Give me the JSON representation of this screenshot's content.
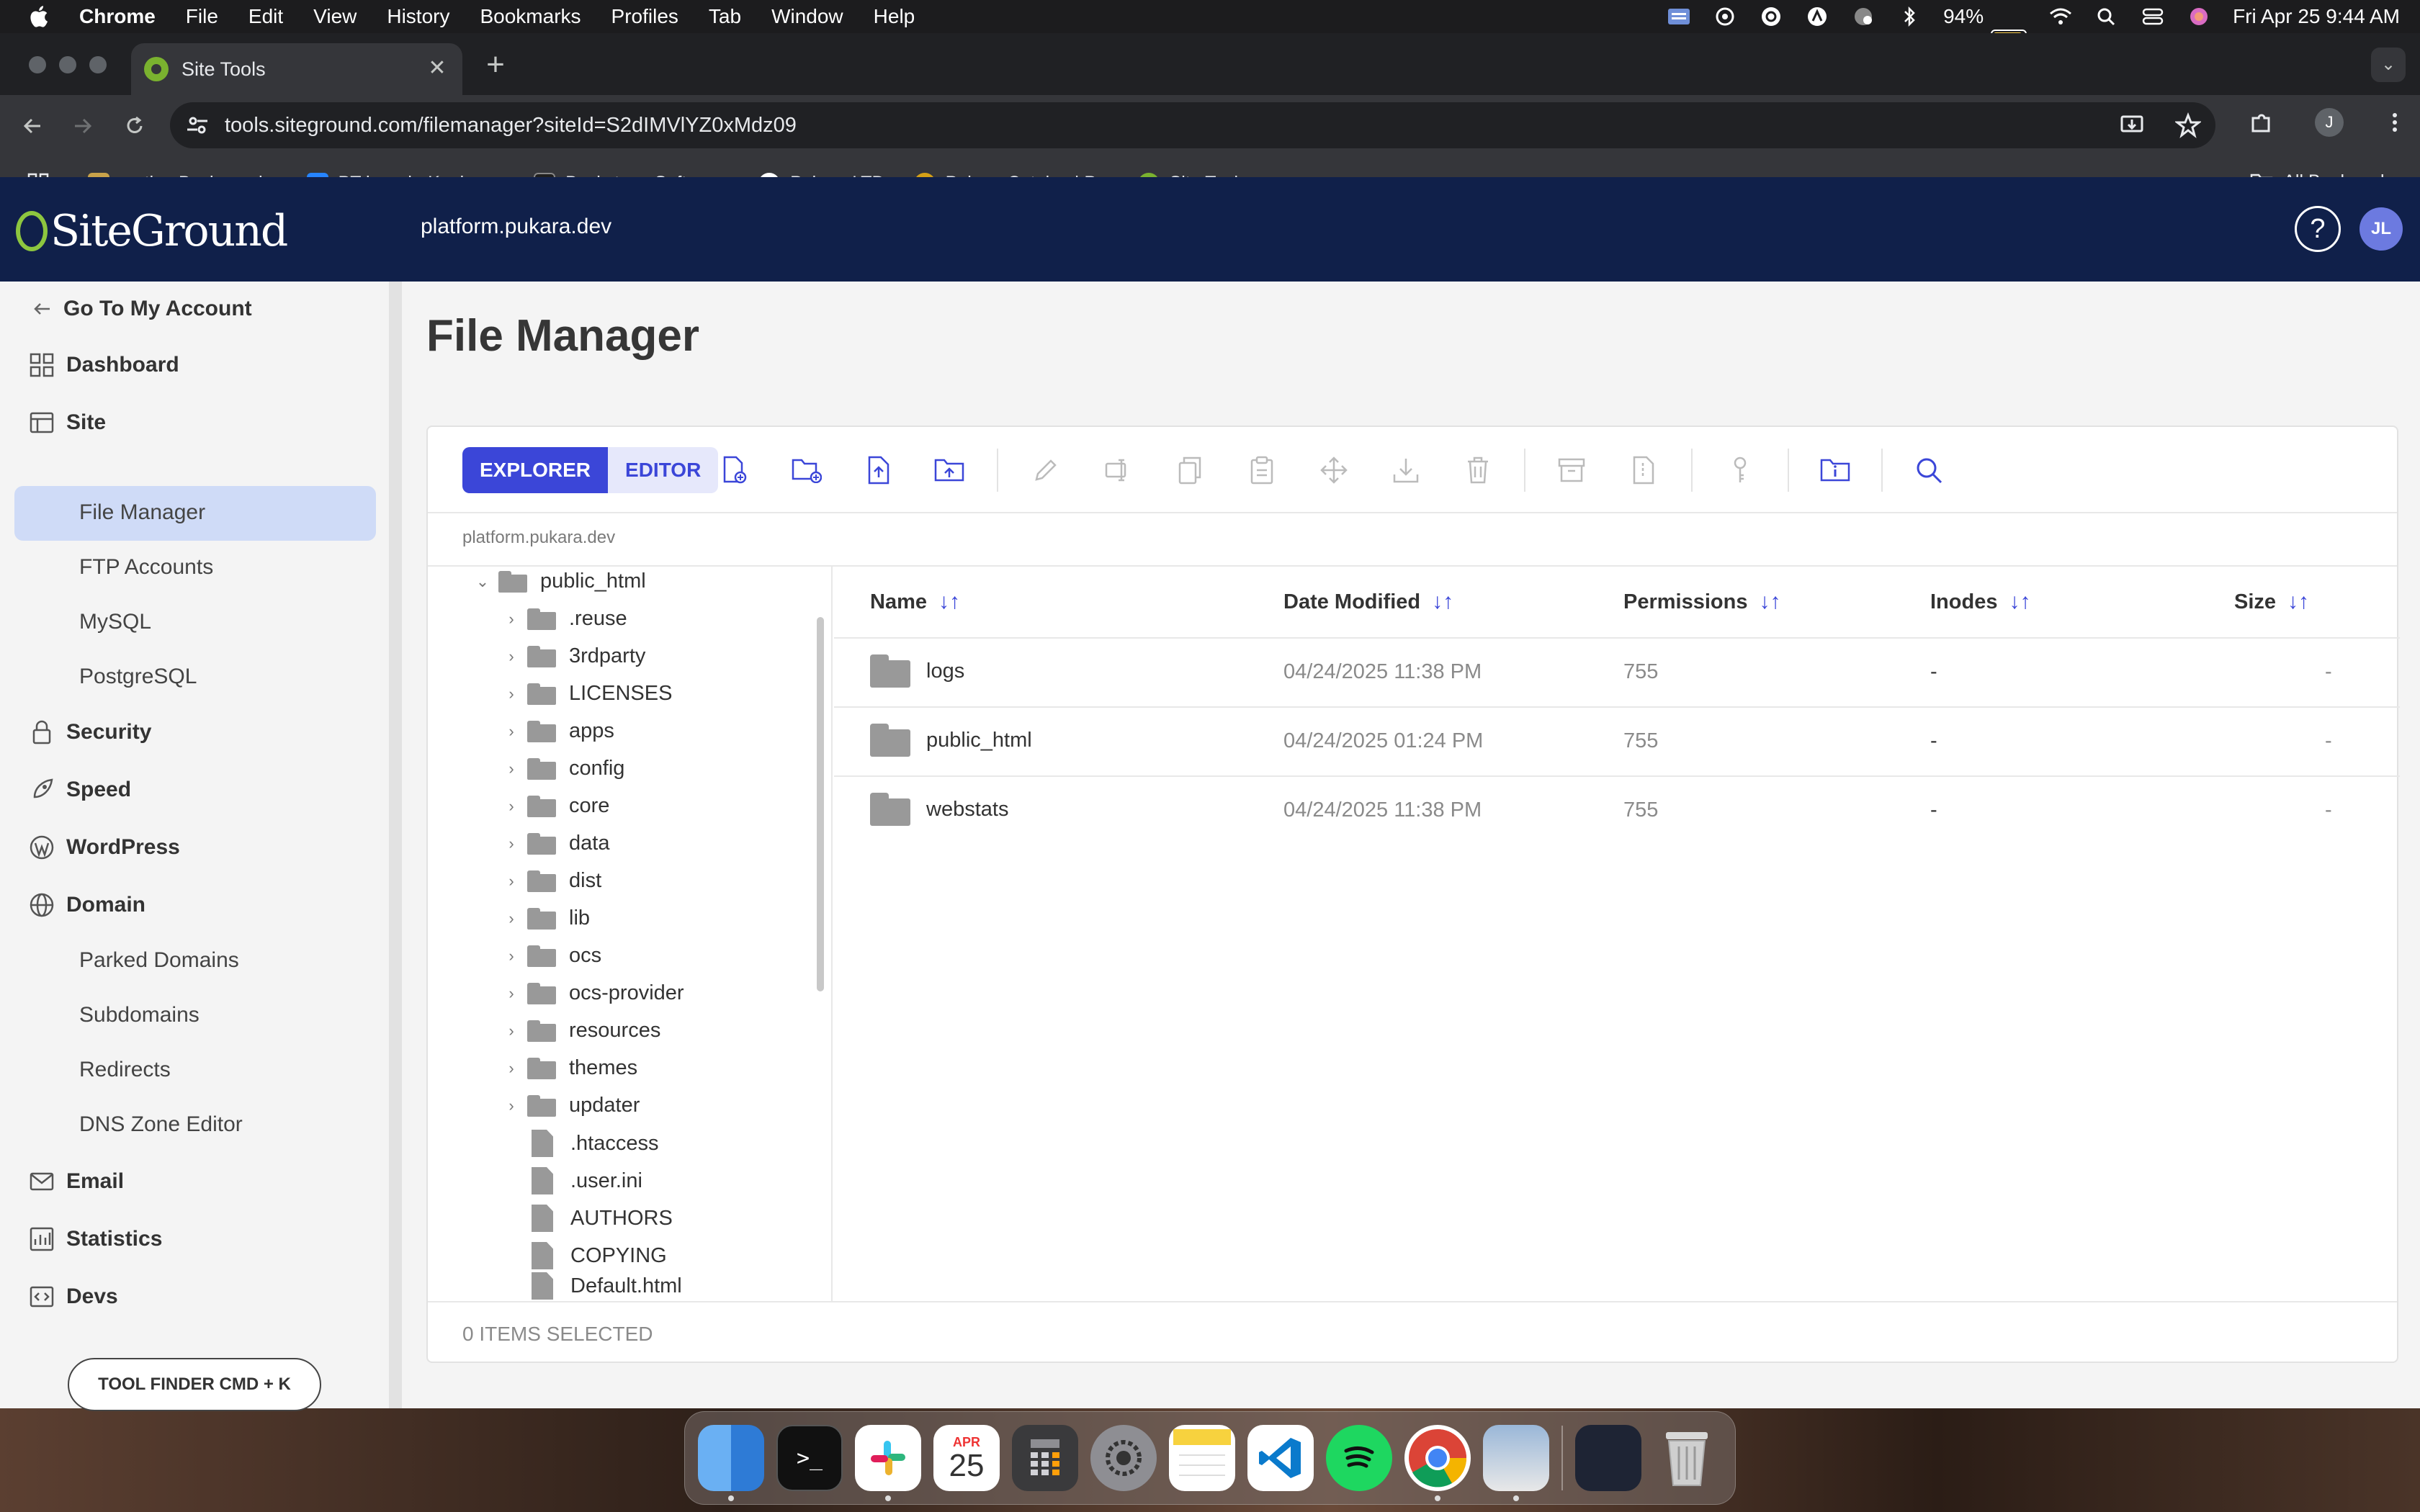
{
  "menubar": {
    "app": "Chrome",
    "items": [
      "File",
      "Edit",
      "View",
      "History",
      "Bookmarks",
      "Profiles",
      "Tab",
      "Window",
      "Help"
    ],
    "battery": "94%",
    "datetime": "Fri Apr 25  9:44 AM"
  },
  "browser": {
    "tab_title": "Site Tools",
    "url": "tools.siteground.com/filemanager?siteId=S2dIMVlYZ0xMdz09",
    "profile_initial": "J",
    "bookmarks": [
      {
        "label": "restic · Backups d...",
        "color": "#c8a24a"
      },
      {
        "label": "PT board - Kanban...",
        "color": "#2684ff"
      },
      {
        "label": "Backstage Softwar...",
        "color": "#1f1f1f"
      },
      {
        "label": "Pukara LTD",
        "color": "#ffffff"
      },
      {
        "label": "Pukara Catalog | P...",
        "color": "#d4a017"
      },
      {
        "label": "Site Tools",
        "color": "#7ab22f"
      }
    ],
    "all_bookmarks": "All Bookmarks"
  },
  "header": {
    "logo": "SiteGround",
    "domain": "platform.pukara.dev",
    "help": "?",
    "user_initials": "JL"
  },
  "sidebar": {
    "back": "Go To My Account",
    "dashboard": "Dashboard",
    "site": "Site",
    "site_items": [
      "File Manager",
      "FTP Accounts",
      "MySQL",
      "PostgreSQL"
    ],
    "security": "Security",
    "speed": "Speed",
    "wordpress": "WordPress",
    "domain": "Domain",
    "domain_items": [
      "Parked Domains",
      "Subdomains",
      "Redirects",
      "DNS Zone Editor"
    ],
    "email": "Email",
    "statistics": "Statistics",
    "devs": "Devs",
    "tool_finder": "TOOL FINDER CMD + K"
  },
  "main": {
    "title": "File Manager",
    "mode_explorer": "EXPLORER",
    "mode_editor": "EDITOR",
    "breadcrumb": "platform.pukara.dev",
    "tree_root": "public_html",
    "tree_folders": [
      ".reuse",
      "3rdparty",
      "LICENSES",
      "apps",
      "config",
      "core",
      "data",
      "dist",
      "lib",
      "ocs",
      "ocs-provider",
      "resources",
      "themes",
      "updater"
    ],
    "tree_files": [
      ".htaccess",
      ".user.ini",
      "AUTHORS",
      "COPYING",
      "Default.html"
    ],
    "columns": {
      "name": "Name",
      "date": "Date Modified",
      "permissions": "Permissions",
      "inodes": "Inodes",
      "size": "Size"
    },
    "rows": [
      {
        "name": "logs",
        "date": "04/24/2025 11:38 PM",
        "permissions": "755",
        "inodes": "-",
        "size": "-"
      },
      {
        "name": "public_html",
        "date": "04/24/2025 01:24 PM",
        "permissions": "755",
        "inodes": "-",
        "size": "-"
      },
      {
        "name": "webstats",
        "date": "04/24/2025 11:38 PM",
        "permissions": "755",
        "inodes": "-",
        "size": "-"
      }
    ],
    "selected_status": "0 ITEMS SELECTED"
  },
  "dock": {
    "calendar_month": "APR",
    "calendar_day": "25"
  }
}
